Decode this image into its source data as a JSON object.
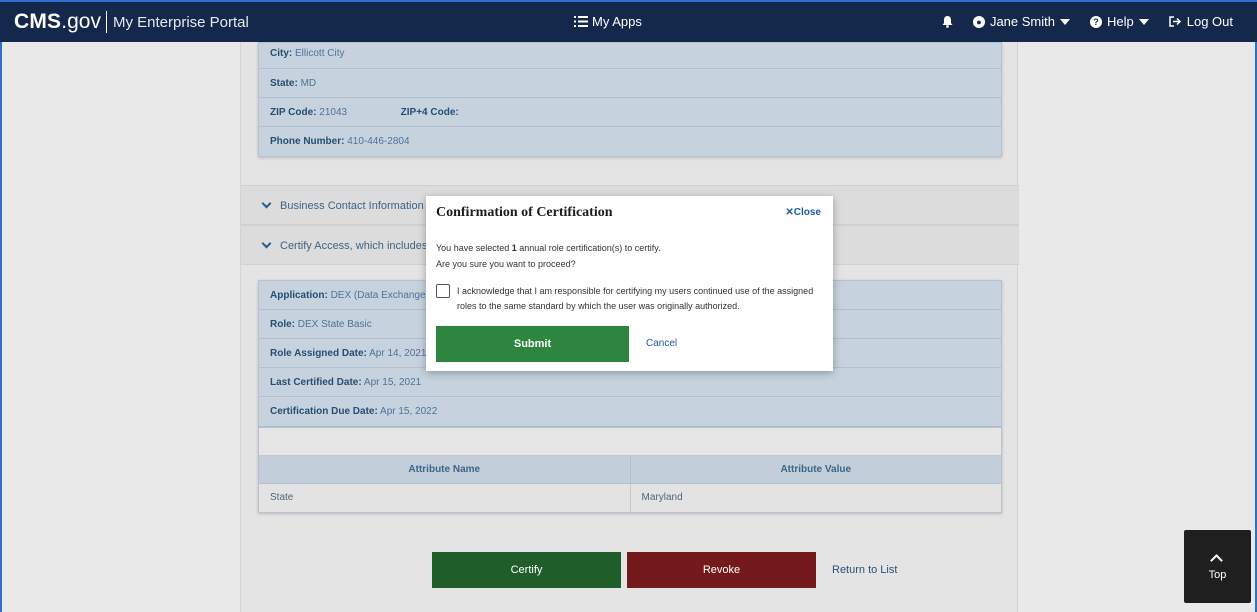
{
  "nav": {
    "brand_cms": "CMS",
    "brand_gov": ".gov",
    "portal_name": "My Enterprise Portal",
    "my_apps": "My Apps",
    "user_name": "Jane Smith",
    "help": "Help",
    "logout": "Log Out"
  },
  "address_card": {
    "city_label": "City:",
    "city_value": "Ellicott City",
    "state_label": "State:",
    "state_value": "MD",
    "zip_label": "ZIP Code:",
    "zip_value": "21043",
    "zip4_label": "ZIP+4 Code:",
    "zip4_value": "",
    "phone_label": "Phone Number:",
    "phone_value": "410-446-2804"
  },
  "accordions": {
    "business_contact": "Business Contact Information",
    "certify_access": "Certify Access, which includes:"
  },
  "role_card": {
    "application_label": "Application:",
    "application_value": "DEX (Data Exchange) S",
    "role_label": "Role:",
    "role_value": "DEX State Basic",
    "assigned_label": "Role Assigned Date:",
    "assigned_value": "Apr 14, 2021",
    "last_cert_label": "Last Certified Date:",
    "last_cert_value": "Apr 15, 2021",
    "due_label": "Certification Due Date:",
    "due_value": "Apr 15, 2022"
  },
  "attributes": {
    "col_name": "Attribute Name",
    "col_value": "Attribute Value",
    "rows": [
      {
        "name": "State",
        "value": "Maryland"
      }
    ]
  },
  "actions": {
    "certify": "Certify",
    "revoke": "Revoke",
    "return_to_list": "Return to List"
  },
  "modal": {
    "title": "Confirmation of Certification",
    "close": "Close",
    "text_before_count": "You have selected ",
    "count": "1",
    "text_after_count": " annual role certification(s) to certify.",
    "question": "Are you sure you want to proceed?",
    "acknowledgement": "I acknowledge that I am responsible for certifying my users continued use of the assigned roles to the same standard by which the user was originally authorized.",
    "submit": "Submit",
    "cancel": "Cancel"
  },
  "back_to_top": "Top",
  "colors": {
    "nav_bg": "#13284b",
    "submit_green": "#2e8540",
    "certify_green": "#1f5d2a",
    "revoke_red": "#751a1c",
    "link_blue": "#1e5aa8"
  }
}
